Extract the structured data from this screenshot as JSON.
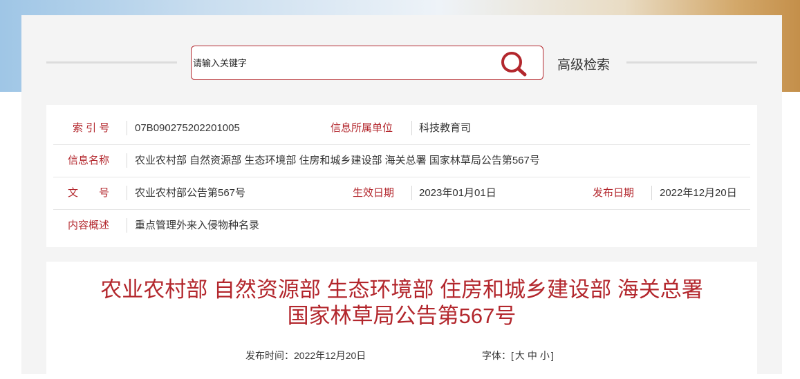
{
  "search": {
    "placeholder": "请输入关键字",
    "advanced_label": "高级检索"
  },
  "meta": {
    "index_label": "索 引 号",
    "index_value": "07B090275202201005",
    "unit_label": "信息所属单位",
    "unit_value": "科技教育司",
    "name_label": "信息名称",
    "name_value": "农业农村部 自然资源部 生态环境部 住房和城乡建设部 海关总署 国家林草局公告第567号",
    "doc_label": "文　　号",
    "doc_value": "农业农村部公告第567号",
    "effective_label": "生效日期",
    "effective_value": "2023年01月01日",
    "publish_label": "发布日期",
    "publish_value": "2022年12月20日",
    "summary_label": "内容概述",
    "summary_value": "重点管理外来入侵物种名录"
  },
  "article": {
    "title_line1": "农业农村部 自然资源部 生态环境部 住房和城乡建设部 海关总署",
    "title_line2": "国家林草局公告第567号",
    "pub_time_label": "发布时间：",
    "pub_time_value": "2022年12月20日",
    "font_label": "字体：",
    "font_open": "[",
    "font_large": "大",
    "font_medium": "中",
    "font_small": "小",
    "font_close": "]"
  },
  "colors": {
    "accent": "#b3272d",
    "panel_bg": "#f4f4f4"
  },
  "icons": {
    "search": "search-icon"
  }
}
